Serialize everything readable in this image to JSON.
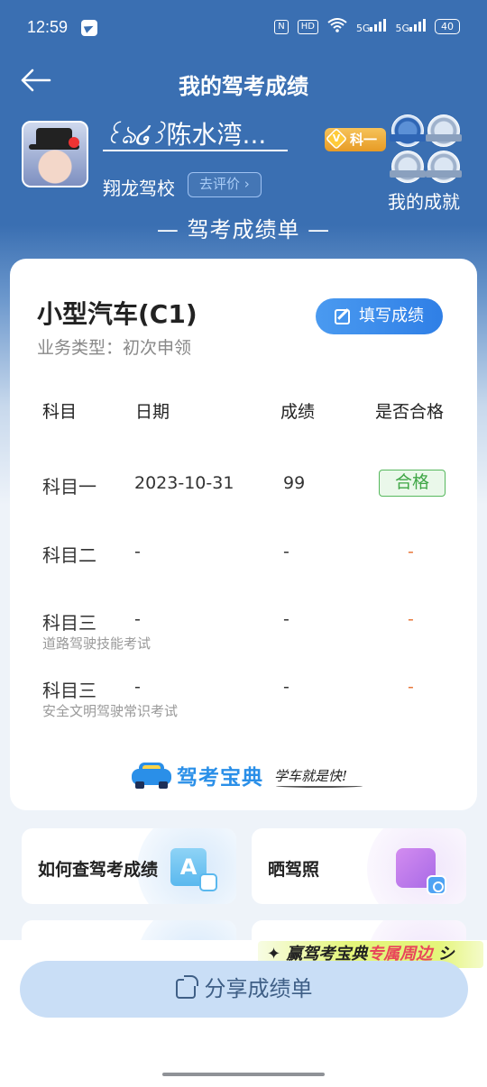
{
  "status_bar": {
    "time": "12:59",
    "nfc": "N",
    "hd": "HD",
    "net1": "5G",
    "net2": "5G",
    "battery": "40"
  },
  "header": {
    "back_icon": "arrow-left-icon",
    "title": "我的驾考成绩"
  },
  "profile": {
    "nickname_deco": "꒰ঌ໒꒱",
    "nickname": "陈水湾...",
    "kemu_badge": "科一",
    "kemu_badge_icon": "V",
    "school": "翔龙驾校",
    "rate_button": "去评价",
    "achievements_label": "我的成就"
  },
  "sheet_title": "— 驾考成绩单 —",
  "card": {
    "vehicle_type": "小型汽车(C1)",
    "business_type": "业务类型：初次申领",
    "fill_button": "填写成绩",
    "headers": [
      "科目",
      "日期",
      "成绩",
      "是否合格"
    ],
    "rows": [
      {
        "subject": "科目一",
        "sub": "",
        "date": "2023-10-31",
        "score": "99",
        "pass": "合格"
      },
      {
        "subject": "科目二",
        "sub": "",
        "date": "-",
        "score": "-",
        "pass": "-"
      },
      {
        "subject": "科目三",
        "sub": "道路驾驶技能考试",
        "date": "-",
        "score": "-",
        "pass": "-"
      },
      {
        "subject": "科目三",
        "sub": "安全文明驾驶常识考试",
        "date": "-",
        "score": "-",
        "pass": "-"
      }
    ],
    "brand_name": "驾考宝典",
    "brand_slogan": "学车就是快!"
  },
  "tiles": [
    {
      "label": "如何查驾考成绩",
      "icon": "A"
    },
    {
      "label": "晒驾照",
      "icon": "photo-icon"
    }
  ],
  "promo": {
    "prefix": "赢驾考宝典",
    "highlight": "专属周边",
    "suffix": "シ"
  },
  "share_button": "分享成绩单",
  "colors": {
    "header_blue": "#3a6fb2",
    "accent_blue": "#2f7fe6",
    "pass_green": "#3fa646",
    "dash_orange": "#e8773a"
  }
}
